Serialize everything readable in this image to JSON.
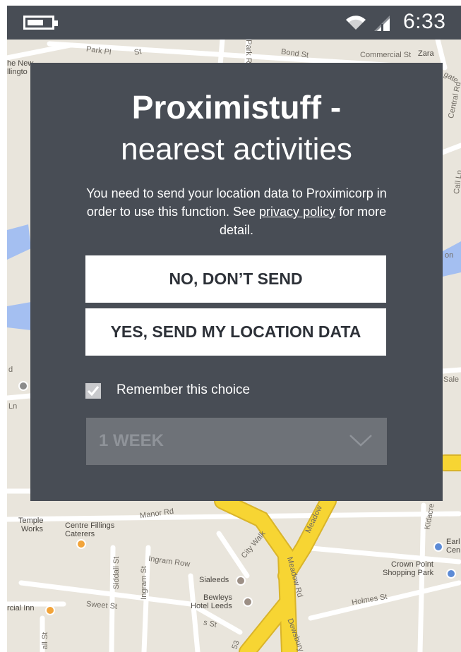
{
  "status_bar": {
    "time": "6:33",
    "battery_level": 0.7
  },
  "map": {
    "labels": [
      "Park Pl",
      "Bond St",
      "Commercial St",
      "Zara",
      "he New",
      "llingto",
      "St",
      "Park Row",
      "Central Rd",
      "gate",
      "on",
      "Call Ln",
      "Sale",
      "d",
      "Ln",
      "Temple",
      "Works",
      "Centre Fillings",
      "Caterers",
      "Manor Rd",
      "Ingram Row",
      "City Walk",
      "Meadow Rd",
      "Meadow",
      "Siddall St",
      "Ingram St",
      "Sialeeds",
      "Bewleys",
      "Hotel Leeds",
      "Crown Point",
      "Shopping Park",
      "Holmes St",
      "Sweet St",
      "rcial Inn",
      "Earl",
      "Cen",
      "Kidacre",
      "Dewsbury",
      "53",
      "all St",
      "s St"
    ]
  },
  "dialog": {
    "title_line1": "Proximistuff -",
    "title_line2": "nearest activities",
    "message_before": "You need to send your location data to Proximicorp in order to use this function. See",
    "privacy_link": "privacy policy",
    "message_after": " for more detail.",
    "no_button": "NO, DON’T SEND",
    "yes_button": "YES, SEND MY LOCATION DATA",
    "remember_label": "Remember this choice",
    "remember_checked": true,
    "duration_value": "1 WEEK"
  },
  "colors": {
    "dialog_bg": "#484d55",
    "status_bar_bg": "#484d55",
    "road_yellow": "#f7d533",
    "water": "#a4bff1",
    "map_bg": "#e9e5dc"
  }
}
